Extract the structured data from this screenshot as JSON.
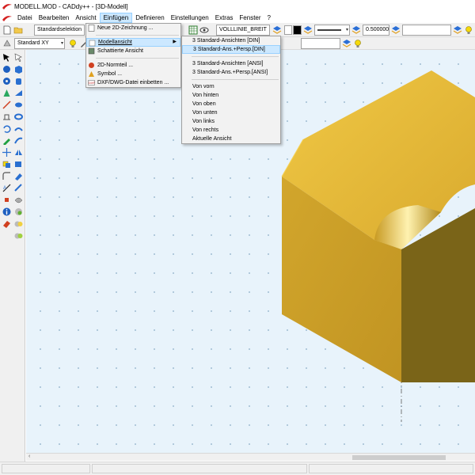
{
  "window": {
    "title": "MODELL.MOD - CADdy++ - [3D-Modell]"
  },
  "menubar": {
    "items": [
      {
        "label": "Datei"
      },
      {
        "label": "Bearbeiten"
      },
      {
        "label": "Ansicht"
      },
      {
        "label": "Einfügen"
      },
      {
        "label": "Definieren"
      },
      {
        "label": "Einstellungen"
      },
      {
        "label": "Extras"
      },
      {
        "label": "Fenster"
      },
      {
        "label": "?"
      }
    ]
  },
  "toolbar1": {
    "selection_combo": "Standardselektion",
    "line_type": "VOLLLINIE_BREIT",
    "line_width": "0.500000",
    "color_swatch": "#000000"
  },
  "toolbar2": {
    "view_combo": "Standard XY"
  },
  "einfuegen_menu": {
    "items": [
      {
        "label": "Neue 2D-Zeichnung ...",
        "icon": "new-drawing-icon"
      },
      {
        "label": "Modellansicht",
        "icon": "model-view-icon"
      },
      {
        "label": "Schattierte Ansicht",
        "icon": "shaded-view-icon"
      },
      {
        "label": "2D-Normteil ...",
        "icon": "standard-part-icon"
      },
      {
        "label": "Symbol ...",
        "icon": "symbol-icon"
      },
      {
        "label": "DXF/DWG-Datei einbetten ...",
        "icon": "dxf-icon"
      }
    ]
  },
  "modellansicht_submenu": {
    "items": [
      {
        "label": "3 Standard-Ansichten [DIN]"
      },
      {
        "label": "3 Standard-Ans.+Persp.[DIN]"
      },
      {
        "label": "3 Standard-Ansichten [ANSI]"
      },
      {
        "label": "3 Standard-Ans.+Persp.[ANSI]"
      },
      {
        "label": "Von vorn"
      },
      {
        "label": "Von hinten"
      },
      {
        "label": "Von oben"
      },
      {
        "label": "Von unten"
      },
      {
        "label": "Von links"
      },
      {
        "label": "Von rechts"
      },
      {
        "label": "Aktuelle Ansicht"
      }
    ]
  },
  "colors": {
    "canvas_background": "#e8f3fb",
    "model_top": "#e3b535",
    "model_front": "#cba02a",
    "model_side": "#7a6418",
    "menu_highlight": "#cce8ff"
  }
}
